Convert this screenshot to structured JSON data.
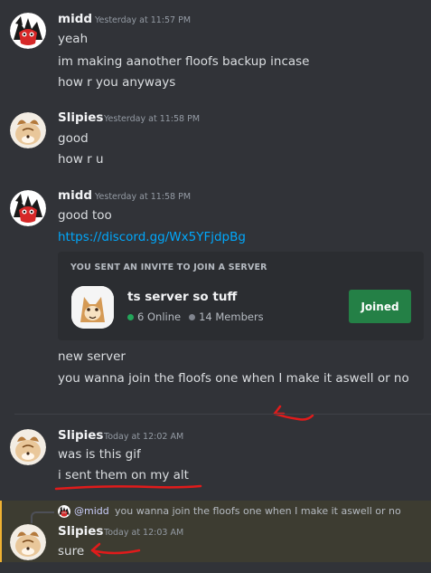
{
  "messages": [
    {
      "author": "midd",
      "timestamp": "Yesterday at 11:57 PM",
      "lines": [
        "yeah",
        "im making aanother floofs backup incase",
        "how r you anyways"
      ]
    },
    {
      "author": "Slipies",
      "timestamp": "Yesterday at 11:58 PM",
      "lines": [
        "good",
        "how r u"
      ]
    },
    {
      "author": "midd",
      "timestamp": "Yesterday at 11:58 PM",
      "lines": [
        "good too"
      ],
      "link": "https://discord.gg/Wx5YFjdpBg",
      "after_lines": [
        "new server",
        "you wanna join the floofs one when I make it aswell or no"
      ]
    },
    {
      "author": "Slipies",
      "timestamp": "Today at 12:02 AM",
      "lines": [
        "was is this gif",
        "i sent them on my alt"
      ]
    },
    {
      "author": "Slipies",
      "timestamp": "Today at 12:03 AM",
      "lines": [
        "sure"
      ]
    }
  ],
  "invite": {
    "header": "YOU SENT AN INVITE TO JOIN A SERVER",
    "server_name": "ts server so tuff",
    "online": "6 Online",
    "members": "14 Members",
    "button_label": "Joined"
  },
  "reply": {
    "mention": "@midd",
    "text": "you wanna join the floofs one when I make it aswell or no"
  },
  "colors": {
    "background": "#313338",
    "link": "#00a8fc",
    "joined_button": "#248046",
    "online_dot": "#23a55a",
    "member_dot": "#80848e",
    "mention_highlight": "#3d3c31",
    "annotation_red": "#e01b1b"
  },
  "icons": {
    "midd_avatar": "red-black-furry-avatar-icon",
    "slipies_avatar": "cream-furry-avatar-icon",
    "server_icon": "fox-server-icon"
  }
}
